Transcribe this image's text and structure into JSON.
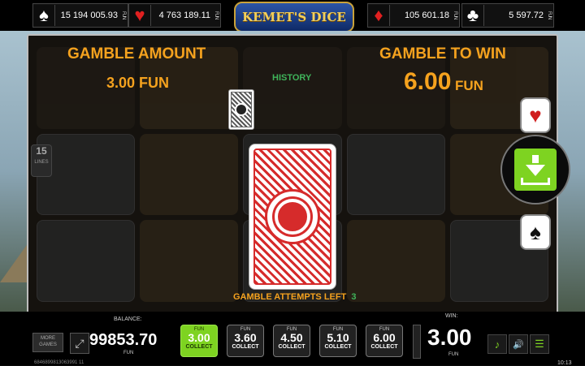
{
  "header": {
    "logo": "KEMET'S DICE",
    "jackpots": [
      {
        "suit": "spade",
        "symbol": "♠",
        "color": "#ffffff",
        "value": "15 194 005.93",
        "currency": "FUN"
      },
      {
        "suit": "heart",
        "symbol": "♥",
        "color": "#e02020",
        "value": "4 763 189.11",
        "currency": "FUN"
      },
      {
        "suit": "diamond",
        "symbol": "♦",
        "color": "#e02020",
        "value": "105 601.18",
        "currency": "FUN"
      },
      {
        "suit": "club",
        "symbol": "♣",
        "color": "#ffffff",
        "value": "5 597.72",
        "currency": "FUN"
      }
    ]
  },
  "gamble": {
    "amount_label": "GAMBLE AMOUNT",
    "amount_value": "3.00 FUN",
    "win_label": "GAMBLE TO WIN",
    "win_value": "6.00",
    "win_currency": "FUN",
    "history_label": "HISTORY",
    "attempts_label": "GAMBLE ATTEMPTS LEFT",
    "attempts_value": "3",
    "lines_value": "15",
    "lines_label": "LINES"
  },
  "side": {
    "red_button": "♥",
    "black_button": "♠",
    "collect_icon": "download-icon"
  },
  "bottom": {
    "balance_label": "BALANCE:",
    "balance_value": "99853.70",
    "balance_currency": "FUN",
    "more_games": "MORE GAMES",
    "fullscreen_icon": "⤢",
    "bets": [
      {
        "currency": "FUN",
        "value": "3.00",
        "action": "COLLECT",
        "active": true
      },
      {
        "currency": "FUN",
        "value": "3.60",
        "action": "COLLECT",
        "active": false
      },
      {
        "currency": "FUN",
        "value": "4.50",
        "action": "COLLECT",
        "active": false
      },
      {
        "currency": "FUN",
        "value": "5.10",
        "action": "COLLECT",
        "active": false
      },
      {
        "currency": "FUN",
        "value": "6.00",
        "action": "COLLECT",
        "active": false
      }
    ],
    "win_label": "WIN:",
    "win_value": "3.00",
    "win_currency": "FUN",
    "music_icon": "♪",
    "sound_icon": "🔊",
    "menu_icon": "☰",
    "ticket_id": "6846899813063991 11",
    "clock": "10:13"
  },
  "colors": {
    "accent_orange": "#f5a21e",
    "accent_green": "#7ed321",
    "card_red": "#d62b2b"
  }
}
